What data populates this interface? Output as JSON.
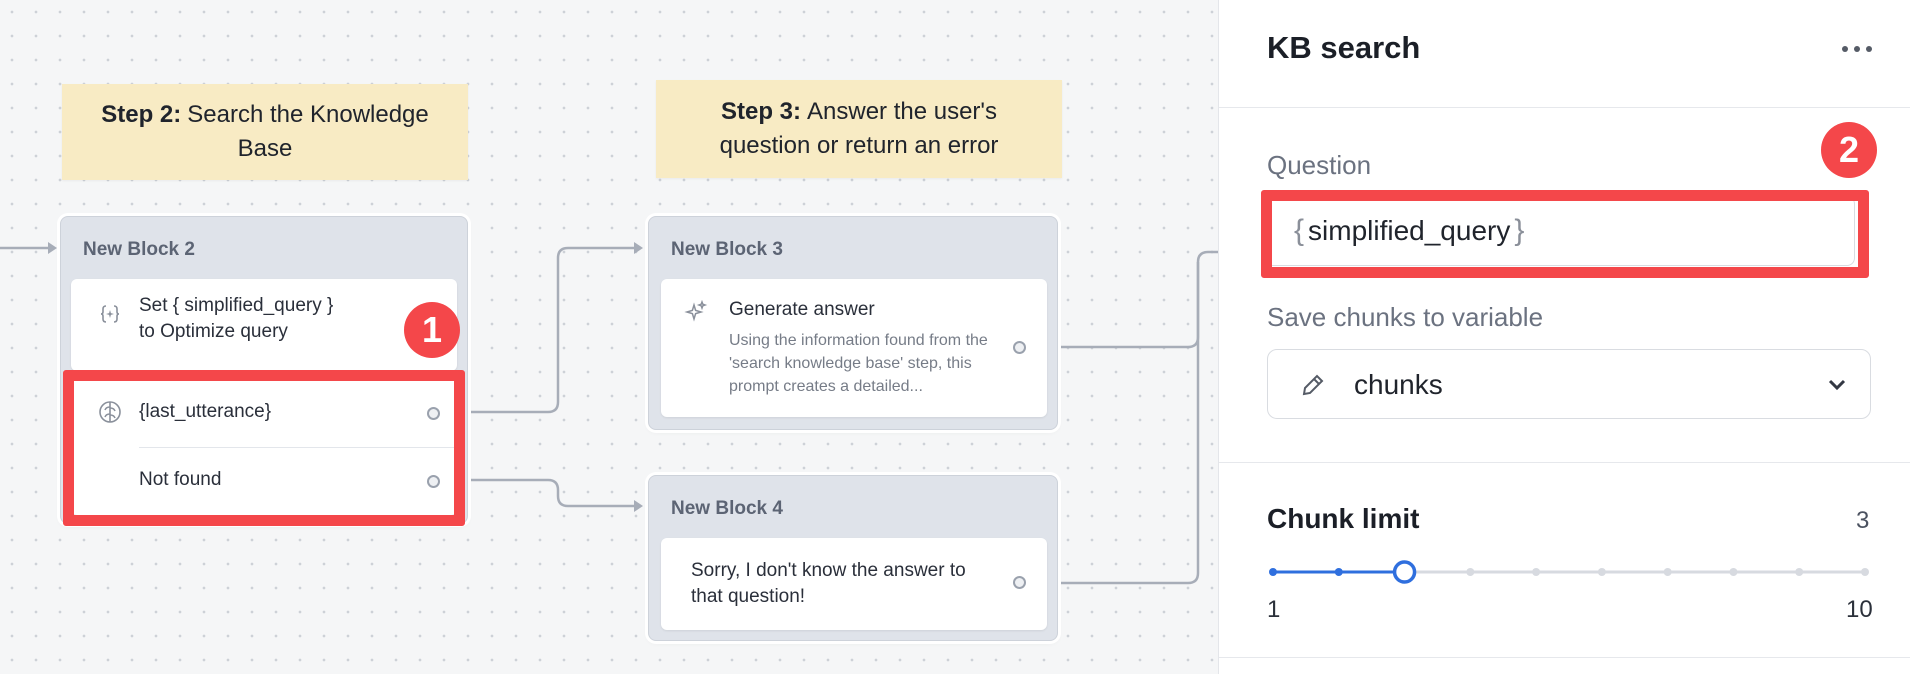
{
  "canvas": {
    "notes": [
      {
        "strong": "Step 2:",
        "text": "Search the Knowledge Base"
      },
      {
        "strong": "Step 3:",
        "text": "Answer the user's question or return an error"
      }
    ],
    "block2": {
      "title": "New Block 2",
      "set_line1": "Set { simplified_query }",
      "set_line2": "to Optimize query",
      "path1": "{last_utterance}",
      "path2": "Not found",
      "badge": "1"
    },
    "block3": {
      "title": "New Block 3",
      "step_title": "Generate answer",
      "step_desc": "Using the information found from the 'search knowledge base' step, this prompt creates a detailed..."
    },
    "block4": {
      "title": "New Block 4",
      "message": "Sorry, I don't know the answer to that question!"
    }
  },
  "panel": {
    "title": "KB search",
    "question_label": "Question",
    "question_value": "simplified_query",
    "brace_open": "{",
    "brace_close": "}",
    "badge": "2",
    "save_label": "Save chunks to variable",
    "save_value": "chunks",
    "chunk_limit_label": "Chunk limit",
    "chunk_limit_value": "3",
    "slider": {
      "min": "1",
      "max": "10",
      "value": 3
    },
    "accent_color": "#2f6fde",
    "highlight_color": "#f4474a"
  }
}
